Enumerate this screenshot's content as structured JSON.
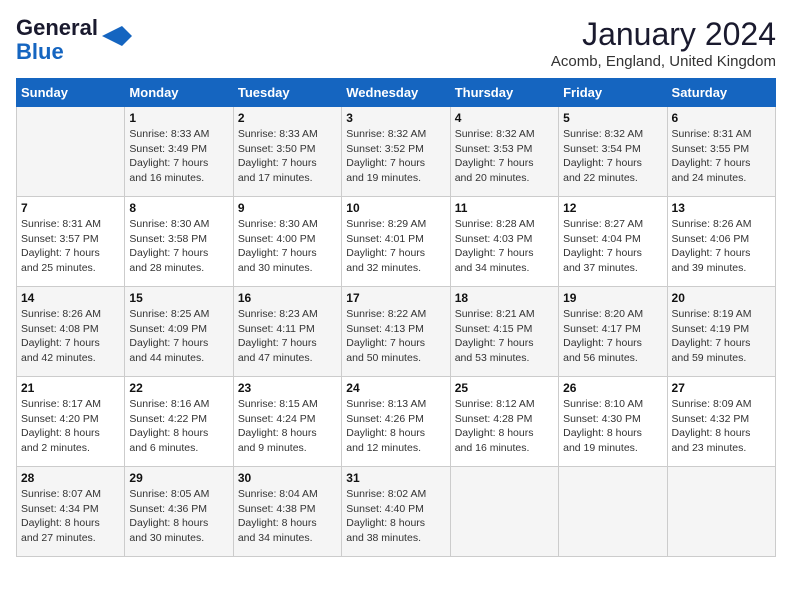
{
  "header": {
    "logo_line1": "General",
    "logo_line2": "Blue",
    "title": "January 2024",
    "subtitle": "Acomb, England, United Kingdom"
  },
  "days_of_week": [
    "Sunday",
    "Monday",
    "Tuesday",
    "Wednesday",
    "Thursday",
    "Friday",
    "Saturday"
  ],
  "weeks": [
    [
      {
        "day": "",
        "info": ""
      },
      {
        "day": "1",
        "info": "Sunrise: 8:33 AM\nSunset: 3:49 PM\nDaylight: 7 hours\nand 16 minutes."
      },
      {
        "day": "2",
        "info": "Sunrise: 8:33 AM\nSunset: 3:50 PM\nDaylight: 7 hours\nand 17 minutes."
      },
      {
        "day": "3",
        "info": "Sunrise: 8:32 AM\nSunset: 3:52 PM\nDaylight: 7 hours\nand 19 minutes."
      },
      {
        "day": "4",
        "info": "Sunrise: 8:32 AM\nSunset: 3:53 PM\nDaylight: 7 hours\nand 20 minutes."
      },
      {
        "day": "5",
        "info": "Sunrise: 8:32 AM\nSunset: 3:54 PM\nDaylight: 7 hours\nand 22 minutes."
      },
      {
        "day": "6",
        "info": "Sunrise: 8:31 AM\nSunset: 3:55 PM\nDaylight: 7 hours\nand 24 minutes."
      }
    ],
    [
      {
        "day": "7",
        "info": "Sunrise: 8:31 AM\nSunset: 3:57 PM\nDaylight: 7 hours\nand 25 minutes."
      },
      {
        "day": "8",
        "info": "Sunrise: 8:30 AM\nSunset: 3:58 PM\nDaylight: 7 hours\nand 28 minutes."
      },
      {
        "day": "9",
        "info": "Sunrise: 8:30 AM\nSunset: 4:00 PM\nDaylight: 7 hours\nand 30 minutes."
      },
      {
        "day": "10",
        "info": "Sunrise: 8:29 AM\nSunset: 4:01 PM\nDaylight: 7 hours\nand 32 minutes."
      },
      {
        "day": "11",
        "info": "Sunrise: 8:28 AM\nSunset: 4:03 PM\nDaylight: 7 hours\nand 34 minutes."
      },
      {
        "day": "12",
        "info": "Sunrise: 8:27 AM\nSunset: 4:04 PM\nDaylight: 7 hours\nand 37 minutes."
      },
      {
        "day": "13",
        "info": "Sunrise: 8:26 AM\nSunset: 4:06 PM\nDaylight: 7 hours\nand 39 minutes."
      }
    ],
    [
      {
        "day": "14",
        "info": "Sunrise: 8:26 AM\nSunset: 4:08 PM\nDaylight: 7 hours\nand 42 minutes."
      },
      {
        "day": "15",
        "info": "Sunrise: 8:25 AM\nSunset: 4:09 PM\nDaylight: 7 hours\nand 44 minutes."
      },
      {
        "day": "16",
        "info": "Sunrise: 8:23 AM\nSunset: 4:11 PM\nDaylight: 7 hours\nand 47 minutes."
      },
      {
        "day": "17",
        "info": "Sunrise: 8:22 AM\nSunset: 4:13 PM\nDaylight: 7 hours\nand 50 minutes."
      },
      {
        "day": "18",
        "info": "Sunrise: 8:21 AM\nSunset: 4:15 PM\nDaylight: 7 hours\nand 53 minutes."
      },
      {
        "day": "19",
        "info": "Sunrise: 8:20 AM\nSunset: 4:17 PM\nDaylight: 7 hours\nand 56 minutes."
      },
      {
        "day": "20",
        "info": "Sunrise: 8:19 AM\nSunset: 4:19 PM\nDaylight: 7 hours\nand 59 minutes."
      }
    ],
    [
      {
        "day": "21",
        "info": "Sunrise: 8:17 AM\nSunset: 4:20 PM\nDaylight: 8 hours\nand 2 minutes."
      },
      {
        "day": "22",
        "info": "Sunrise: 8:16 AM\nSunset: 4:22 PM\nDaylight: 8 hours\nand 6 minutes."
      },
      {
        "day": "23",
        "info": "Sunrise: 8:15 AM\nSunset: 4:24 PM\nDaylight: 8 hours\nand 9 minutes."
      },
      {
        "day": "24",
        "info": "Sunrise: 8:13 AM\nSunset: 4:26 PM\nDaylight: 8 hours\nand 12 minutes."
      },
      {
        "day": "25",
        "info": "Sunrise: 8:12 AM\nSunset: 4:28 PM\nDaylight: 8 hours\nand 16 minutes."
      },
      {
        "day": "26",
        "info": "Sunrise: 8:10 AM\nSunset: 4:30 PM\nDaylight: 8 hours\nand 19 minutes."
      },
      {
        "day": "27",
        "info": "Sunrise: 8:09 AM\nSunset: 4:32 PM\nDaylight: 8 hours\nand 23 minutes."
      }
    ],
    [
      {
        "day": "28",
        "info": "Sunrise: 8:07 AM\nSunset: 4:34 PM\nDaylight: 8 hours\nand 27 minutes."
      },
      {
        "day": "29",
        "info": "Sunrise: 8:05 AM\nSunset: 4:36 PM\nDaylight: 8 hours\nand 30 minutes."
      },
      {
        "day": "30",
        "info": "Sunrise: 8:04 AM\nSunset: 4:38 PM\nDaylight: 8 hours\nand 34 minutes."
      },
      {
        "day": "31",
        "info": "Sunrise: 8:02 AM\nSunset: 4:40 PM\nDaylight: 8 hours\nand 38 minutes."
      },
      {
        "day": "",
        "info": ""
      },
      {
        "day": "",
        "info": ""
      },
      {
        "day": "",
        "info": ""
      }
    ]
  ]
}
